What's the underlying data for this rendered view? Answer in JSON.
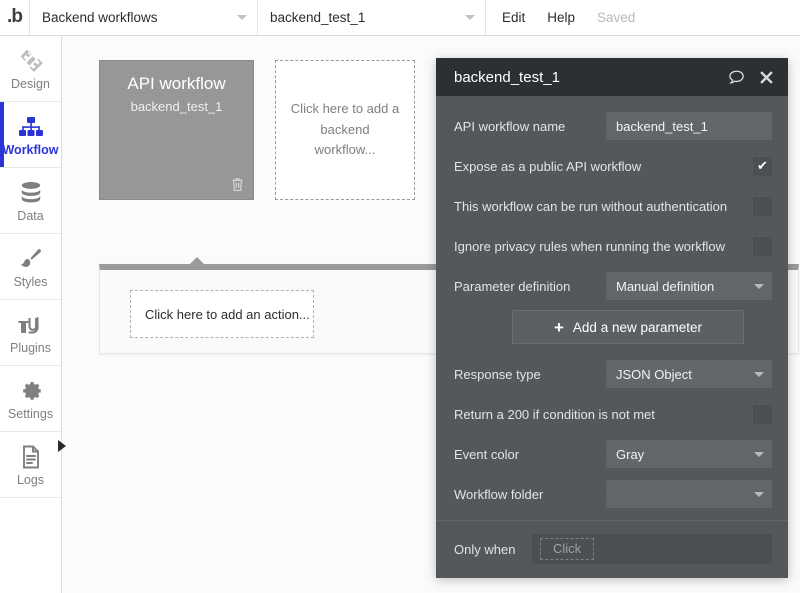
{
  "topbar": {
    "logo": "b-logo-icon",
    "logo_text": ".b",
    "workflow_type_select": "Backend workflows",
    "workflow_select": "backend_test_1",
    "edit_label": "Edit",
    "help_label": "Help",
    "save_status": "Saved"
  },
  "sidebar": {
    "items": [
      {
        "label": "Design",
        "icon": "design-icon",
        "active": false
      },
      {
        "label": "Workflow",
        "icon": "workflow-icon",
        "active": true
      },
      {
        "label": "Data",
        "icon": "data-icon",
        "active": false
      },
      {
        "label": "Styles",
        "icon": "styles-icon",
        "active": false
      },
      {
        "label": "Plugins",
        "icon": "plugins-icon",
        "active": false
      },
      {
        "label": "Settings",
        "icon": "settings-icon",
        "active": false
      },
      {
        "label": "Logs",
        "icon": "logs-icon",
        "active": false
      }
    ],
    "expander_icon": "chevron-right-icon"
  },
  "canvas": {
    "workflow_card": {
      "title": "API workflow",
      "subtitle": "backend_test_1",
      "delete_icon": "trash-icon"
    },
    "add_workflow_placeholder": "Click here to add a backend workflow...",
    "add_action_placeholder": "Click here to add an action..."
  },
  "panel": {
    "title": "backend_test_1",
    "comment_icon": "comment-icon",
    "close_icon": "close-icon",
    "fields": {
      "api_workflow_name_label": "API workflow name",
      "api_workflow_name_value": "backend_test_1",
      "expose_public_label": "Expose as a public API workflow",
      "expose_public_checked": "✔",
      "no_auth_label": "This workflow can be run without authentication",
      "no_auth_checked": "",
      "ignore_privacy_label": "Ignore privacy rules when running the workflow",
      "ignore_privacy_checked": "",
      "parameter_definition_label": "Parameter definition",
      "parameter_definition_value": "Manual definition",
      "add_parameter_label": "Add a new parameter",
      "add_parameter_plus": "+",
      "response_type_label": "Response type",
      "response_type_value": "JSON Object",
      "return_200_label": "Return a 200 if condition is not met",
      "return_200_checked": "",
      "event_color_label": "Event color",
      "event_color_value": "Gray",
      "workflow_folder_label": "Workflow folder",
      "workflow_folder_value": "",
      "only_when_label": "Only when",
      "only_when_placeholder": "Click"
    }
  },
  "colors": {
    "accent_blue": "#2b35d6",
    "panel_bg": "#54585c",
    "panel_header_bg": "#2c3034",
    "card_gray": "#969696"
  }
}
